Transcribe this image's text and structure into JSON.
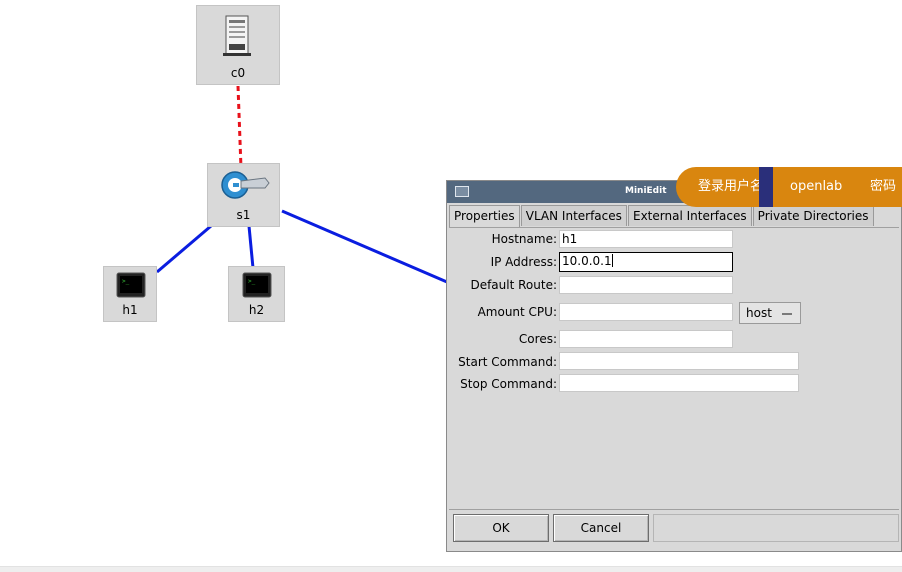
{
  "nodes": {
    "c0": {
      "label": "c0",
      "icon": "controller-server-icon"
    },
    "s1": {
      "label": "s1",
      "icon": "switch-icon"
    },
    "h1": {
      "label": "h1",
      "icon": "host-terminal-icon"
    },
    "h2": {
      "label": "h2",
      "icon": "host-terminal-icon"
    }
  },
  "colors": {
    "controller_link": "#e8111b",
    "data_link": "#0a1de0",
    "node_bg": "#d9d9d9",
    "titlebar": "#53687f",
    "banner": "#d9860f"
  },
  "dialog": {
    "title": "MiniEdit",
    "tabs": [
      "Properties",
      "VLAN Interfaces",
      "External Interfaces",
      "Private Directories"
    ],
    "active_tab": "Properties",
    "fields": {
      "hostname": {
        "label": "Hostname:",
        "value": "h1"
      },
      "ip": {
        "label": "IP Address:",
        "value": "10.0.0.1"
      },
      "route": {
        "label": "Default Route:",
        "value": ""
      },
      "cpu": {
        "label": "Amount CPU:",
        "value": ""
      },
      "cpu_mode": "host",
      "cores": {
        "label": "Cores:",
        "value": ""
      },
      "start_cmd": {
        "label": "Start Command:",
        "value": ""
      },
      "stop_cmd": {
        "label": "Stop Command:",
        "value": ""
      }
    },
    "buttons": {
      "ok": "OK",
      "cancel": "Cancel"
    }
  },
  "banner": {
    "label": "登录用户名:",
    "username": "openlab",
    "password_label": "密码"
  }
}
